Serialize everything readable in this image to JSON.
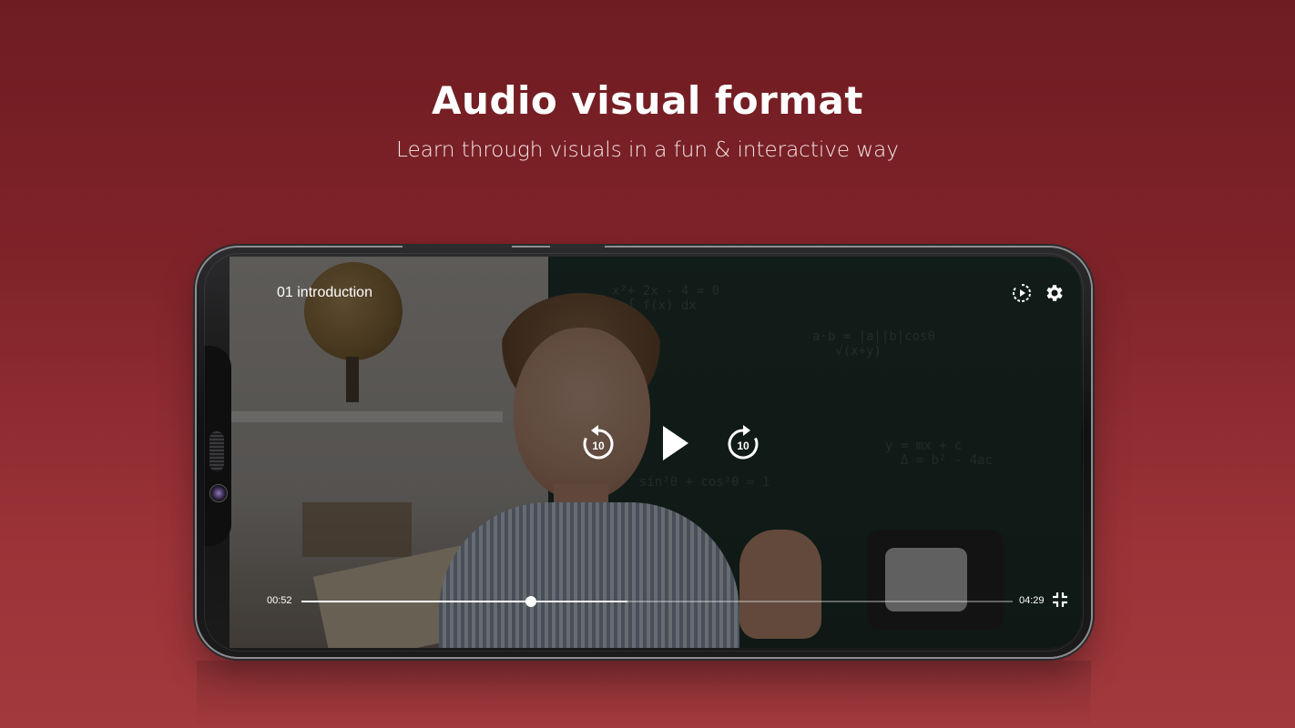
{
  "headline": "Audio visual format",
  "subheadline": "Learn through visuals in a fun & interactive way",
  "player": {
    "title": "01 introduction",
    "current_time": "00:52",
    "total_time": "04:29",
    "progress_fraction": 0.323,
    "buffered_fraction": 0.458,
    "rewind_label": "10",
    "forward_label": "10",
    "icons": {
      "autoplay": "autoplay-icon",
      "settings": "gear-icon",
      "rewind": "rewind-10-icon",
      "play": "play-icon",
      "forward": "forward-10-icon",
      "fullscreen": "exit-fullscreen-icon"
    }
  },
  "colors": {
    "background_top": "#6e1c22",
    "background_bottom": "#a1393d",
    "text": "#ffffff"
  }
}
